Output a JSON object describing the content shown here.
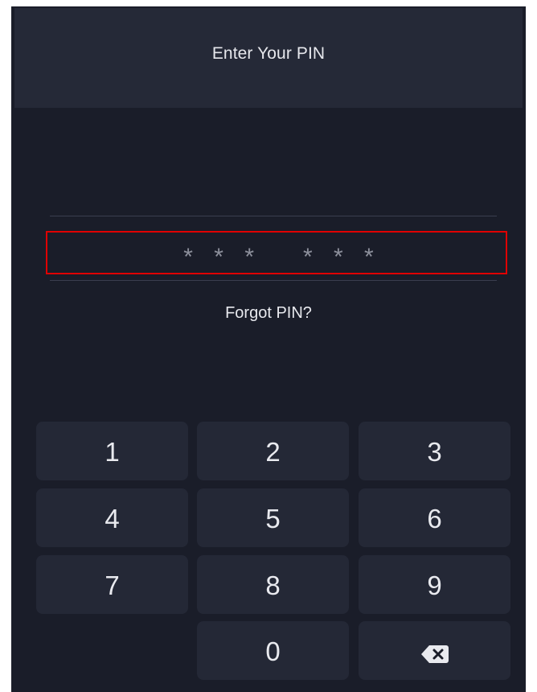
{
  "header": {
    "title": "Enter Your PIN"
  },
  "pin": {
    "masked_value": "* * *   * * *"
  },
  "links": {
    "forgot": "Forgot PIN?"
  },
  "keypad": {
    "keys": [
      "1",
      "2",
      "3",
      "4",
      "5",
      "6",
      "7",
      "8",
      "9",
      "0"
    ],
    "backspace_icon": "backspace-icon"
  },
  "colors": {
    "background": "#1a1d29",
    "header": "#252937",
    "key": "#242836",
    "highlight": "#e00000"
  }
}
